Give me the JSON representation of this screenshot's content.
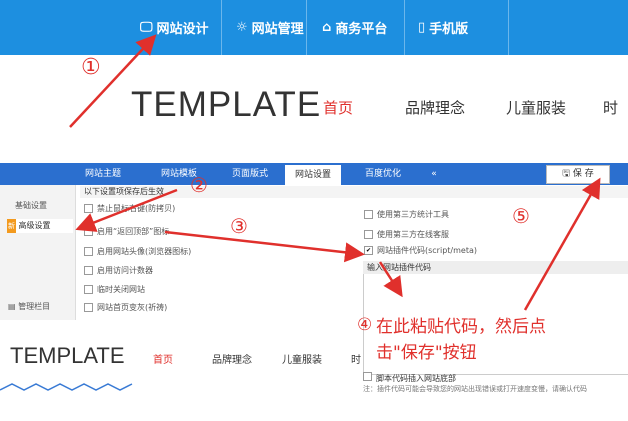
{
  "top_bar": {
    "buttons": [
      {
        "icon": "monitor-icon",
        "glyph": "🖵",
        "label": "网站设计"
      },
      {
        "icon": "gear-icon",
        "glyph": "☼",
        "label": "网站管理"
      },
      {
        "icon": "home-icon",
        "glyph": "⌂",
        "label": "商务平台"
      },
      {
        "icon": "phone-icon",
        "glyph": "▯",
        "label": "手机版"
      }
    ]
  },
  "preview1": {
    "logo": "TEMPLATE",
    "nav": [
      "首页",
      "品牌理念",
      "儿童服装",
      "时"
    ]
  },
  "settings": {
    "tabs": [
      "网站主题",
      "网站模板",
      "页面版式",
      "网站设置",
      "百度优化",
      "«"
    ],
    "save_label": "保 存",
    "sidebar": {
      "basic": "基础设置",
      "advanced": "高级设置",
      "advanced_badge": "新",
      "manage": "管理栏目"
    },
    "panel_header": "以下设置项保存后生效",
    "left_options": [
      "禁止鼠标右键(防拷贝)",
      "启用“返回顶部”图标",
      "启用网站头像(浏览器图标)",
      "启用访问计数器",
      "临时关闭网站",
      "网站首页变灰(祈祷)"
    ],
    "right_options": [
      {
        "label": "使用第三方统计工具",
        "checked": false
      },
      {
        "label": "使用第三方在线客服",
        "checked": false
      },
      {
        "label": "网站插件代码(script/meta)",
        "checked": true
      }
    ],
    "code_title": "输入网站插件代码",
    "footer_option": "脚本代码插入网站底部",
    "footer_note": "注：插件代码可能会导致您的网站出现错误或打开速度变慢，请确认代码"
  },
  "preview2": {
    "logo": "TEMPLATE",
    "nav": [
      "首页",
      "品牌理念",
      "儿童服装",
      "时"
    ]
  },
  "annotations": {
    "steps": [
      "①",
      "②",
      "③",
      "④",
      "⑤"
    ],
    "instruction_line1": "在此粘贴代码，然后点",
    "instruction_line2": "击\"保存\"按钮"
  },
  "colors": {
    "topbar": "#1d8fe0",
    "tabbar": "#2b6fcf",
    "accent_red": "#e0302c"
  }
}
